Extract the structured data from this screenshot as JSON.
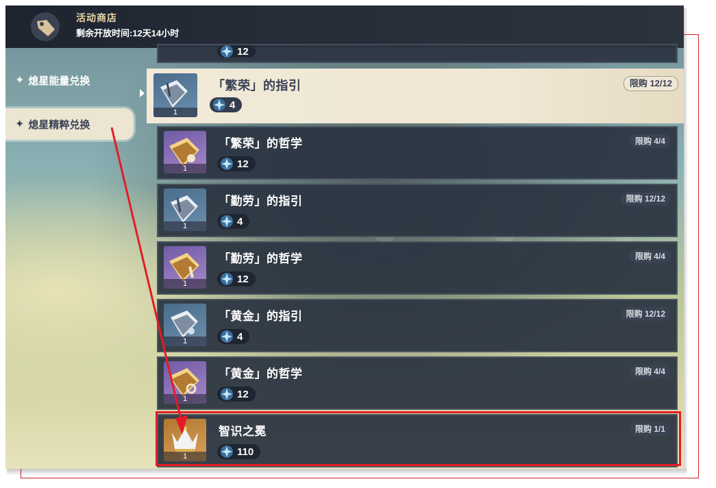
{
  "header": {
    "title": "活动商店",
    "timer": "剩余开放时间:12天14小时"
  },
  "sidebar": {
    "items": [
      {
        "label": "熄星能量兑换",
        "selected": false
      },
      {
        "label": "熄星精粹兑换",
        "selected": true
      }
    ]
  },
  "list": {
    "peek_price": "12",
    "items": [
      {
        "name": "「繁荣」的指引",
        "price": "4",
        "limit": "限购 12/12",
        "count": "1",
        "selected": true,
        "icon": "guide-book-icon"
      },
      {
        "name": "「繁荣」的哲学",
        "price": "12",
        "limit": "限购 4/4",
        "count": "1",
        "selected": false,
        "icon": "philosophy-book-icon"
      },
      {
        "name": "「勤劳」的指引",
        "price": "4",
        "limit": "限购 12/12",
        "count": "1",
        "selected": false,
        "icon": "guide-book-icon"
      },
      {
        "name": "「勤劳」的哲学",
        "price": "12",
        "limit": "限购 4/4",
        "count": "1",
        "selected": false,
        "icon": "philosophy-book-icon"
      },
      {
        "name": "「黄金」的指引",
        "price": "4",
        "limit": "限购 12/12",
        "count": "1",
        "selected": false,
        "icon": "guide-book-icon"
      },
      {
        "name": "「黄金」的哲学",
        "price": "12",
        "limit": "限购 4/4",
        "count": "1",
        "selected": false,
        "icon": "philosophy-book-icon"
      },
      {
        "name": "智识之冕",
        "price": "110",
        "limit": "限购 1/1",
        "count": "1",
        "selected": false,
        "icon": "crown-icon"
      }
    ]
  },
  "colors": {
    "annotation_red": "#e21d26",
    "row_bg": "#2c3542",
    "selected_bg": "#f1ead8",
    "accent_gold": "#e9d6a9"
  }
}
